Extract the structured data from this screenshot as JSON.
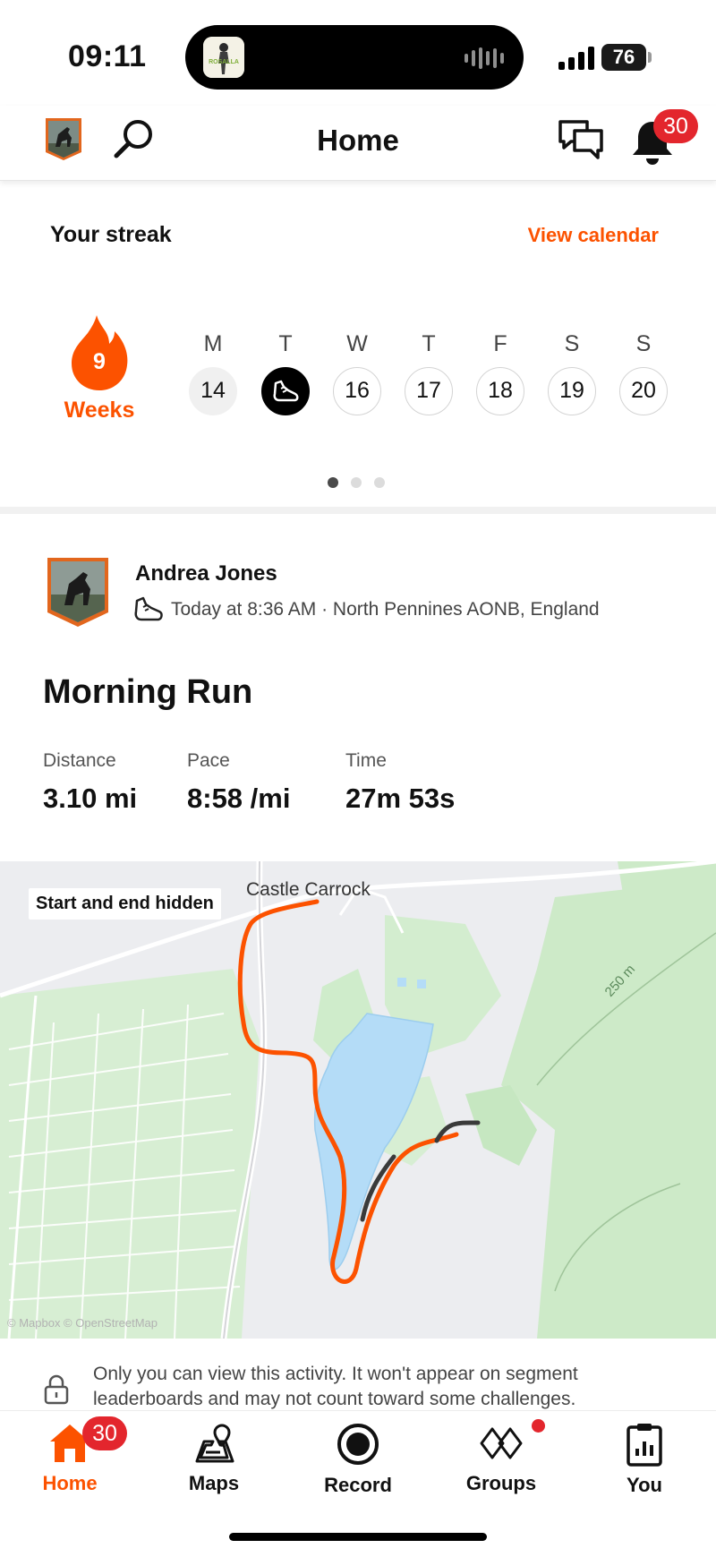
{
  "status_bar": {
    "time": "09:11",
    "battery": "76",
    "now_playing_art_label": "ROSALLA"
  },
  "header": {
    "title": "Home",
    "notification_count": "30"
  },
  "streak": {
    "title": "Your streak",
    "view_calendar_label": "View calendar",
    "weeks_count": "9",
    "weeks_label": "Weeks",
    "days": [
      {
        "letter": "M",
        "date": "14",
        "state": "past"
      },
      {
        "letter": "T",
        "date": "",
        "state": "done"
      },
      {
        "letter": "W",
        "date": "16",
        "state": "upcoming"
      },
      {
        "letter": "T",
        "date": "17",
        "state": "upcoming"
      },
      {
        "letter": "F",
        "date": "18",
        "state": "upcoming"
      },
      {
        "letter": "S",
        "date": "19",
        "state": "upcoming"
      },
      {
        "letter": "S",
        "date": "20",
        "state": "upcoming"
      }
    ],
    "pager_pages": 3,
    "pager_active": 0
  },
  "activity": {
    "athlete_name": "Andrea Jones",
    "meta": "Today at 8:36 AM · North Pennines AONB, England",
    "title": "Morning Run",
    "stats": [
      {
        "label": "Distance",
        "value": "3.10 mi"
      },
      {
        "label": "Pace",
        "value": "8:58 /mi"
      },
      {
        "label": "Time",
        "value": "27m 53s"
      }
    ],
    "map": {
      "badge": "Start and end hidden",
      "place_label": "Castle Carrock",
      "contour_label": "250 m",
      "attribution": "© Mapbox © OpenStreetMap"
    },
    "privacy_note": "Only you can view this activity. It won't appear on segment leaderboards and may not count toward some challenges."
  },
  "bottom_nav": {
    "items": [
      {
        "label": "Home",
        "icon": "home-icon",
        "active": true
      },
      {
        "label": "Maps",
        "icon": "maps-icon",
        "active": false
      },
      {
        "label": "Record",
        "icon": "record-icon",
        "active": false
      },
      {
        "label": "Groups",
        "icon": "groups-icon",
        "active": false
      },
      {
        "label": "You",
        "icon": "you-icon",
        "active": false
      }
    ],
    "home_badge": "30"
  },
  "colors": {
    "accent": "#fc5200",
    "badge": "#e3262d",
    "water": "#b4dcf7",
    "forest": "#cfeccb",
    "route": "#fc5200",
    "route_hidden": "#3a3a3a"
  }
}
